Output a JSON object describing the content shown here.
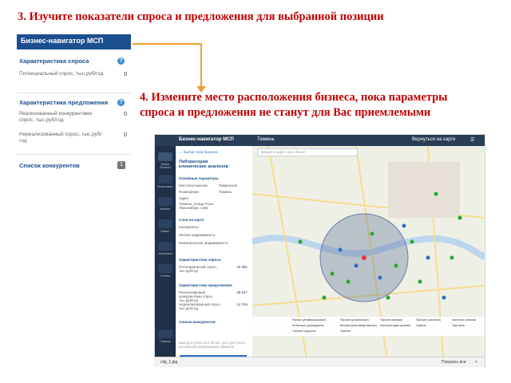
{
  "instructions": {
    "step3": "3. Изучите показатели спроса и предложения для выбранной позиции",
    "step4_line1": "4. Измените место расположения бизнеса,  пока параметры",
    "step4_line2": "спроса и предложения не станут для Вас приемлемыми"
  },
  "panel": {
    "title": "Бизнес-навигатор МСП",
    "demand_section": "Характеристика спроса",
    "potential_demand_label": "Потенциальный спрос, тыс.руб/год",
    "potential_demand_value": "0",
    "supply_section": "Характеристика предложения",
    "realized_by_competitors_label": "Реализованный конкурентами спрос, тыс.руб/год",
    "realized_by_competitors_value": "0",
    "unrealized_label": "Нереализованный спрос, тыс.руб/год",
    "unrealized_value": "0",
    "competitors_label": "Список конкурентов",
    "competitors_count": "1"
  },
  "app": {
    "title": "Бизнес-навигатор МСП",
    "city": "Тюмень",
    "back_link": "← Выбор типа бизнеса",
    "business_title": "Лаборатории клинических анализов",
    "params_header": "Основные параметры",
    "location_label": "Местоположение",
    "location_value": "Тюменская",
    "property_label": "Помещение",
    "property_value": "Тюмень",
    "address_label": "Адрес",
    "address_value": "Тюмень, улица Розы Люксембург, 13к6",
    "layers_header": "Слои на карте",
    "layer1": "Конкуренты",
    "layer2": "Жилая недвижимость",
    "layer3": "Коммерческая недвижимость",
    "demand_header": "Характеристика спроса",
    "demand_row": "Потенциальный спрос, тыс.руб/год",
    "demand_value": "43 381",
    "supply_header": "Характеристика предложения",
    "supply_row1": "Реализованный конкурентами спрос, тыс.руб/год",
    "supply_value1": "28 617",
    "supply_row2": "Нереализованный спрос, тыс.руб/год",
    "supply_value2": "14 764",
    "competitors_link": "Список конкурентов",
    "note": "Вам доступны все блоки. Для доступа к детальной информации нажмите",
    "calc_button": "Рассчитать бизнес-план",
    "search_placeholder": "Введите адрес или объект",
    "back_to_map": "Вернуться на карте",
    "nav": [
      "Выбор бизнеса",
      "Мониторинг",
      "Каталог",
      "Инвест",
      "Аналитика",
      "Отчёты",
      "Помощь"
    ],
    "legend": [
      "Рынки (универсальные)",
      "Прочие (розничные)",
      "Прочие клиники",
      "Прочие (частные)",
      "Частные клиники",
      "Аптечные учреждения",
      "Жилая (многоквартирная)",
      "Консультации врачей",
      "Офисы",
      "Торговля",
      "Салоны красоты",
      "Прочее"
    ]
  },
  "taskbar": {
    "file": "clip_1.jpg",
    "show_all": "Показать все"
  },
  "colors": {
    "accent_red": "#c00000",
    "header_blue": "#1c4f8f",
    "arrow_orange": "#f0a030"
  }
}
